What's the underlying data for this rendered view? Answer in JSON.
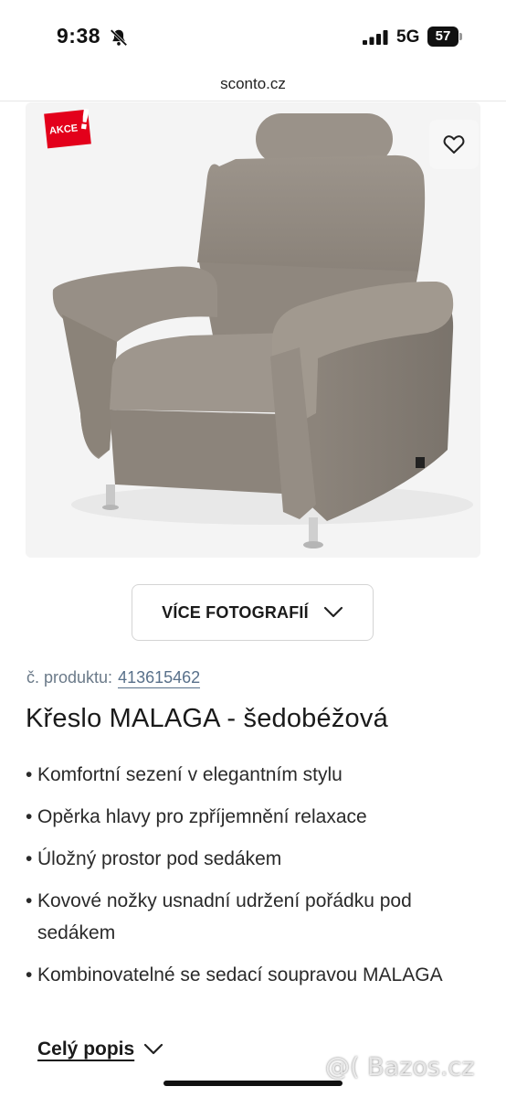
{
  "status_bar": {
    "time": "9:38",
    "network": "5G",
    "battery": "57",
    "icons": [
      "bell-slash-icon",
      "cellular-signal-icon",
      "battery-icon"
    ]
  },
  "browser": {
    "url": "sconto.cz"
  },
  "product_image": {
    "badge": "AKCE",
    "badge_color": "#e3001b",
    "wishlist_icon": "heart-icon"
  },
  "more_photos": {
    "label": "VÍCE FOTOGRAFIÍ",
    "icon": "chevron-down-icon"
  },
  "product": {
    "number_label": "č. produktu:",
    "number": "413615462",
    "title": "Křeslo MALAGA - šedobéžová",
    "features": [
      "Komfortní sezení v elegantním stylu",
      "Opěrka hlavy pro zpříjemnění relaxace",
      "Úložný prostor pod sedákem",
      "Kovové nožky usnadní udržení pořádku pod sedákem",
      "Kombinovatelné se sedací soupravou MALAGA"
    ]
  },
  "full_description": {
    "label": "Celý popis",
    "icon": "chevron-down-icon"
  },
  "watermark": "@( Bazos.cz"
}
